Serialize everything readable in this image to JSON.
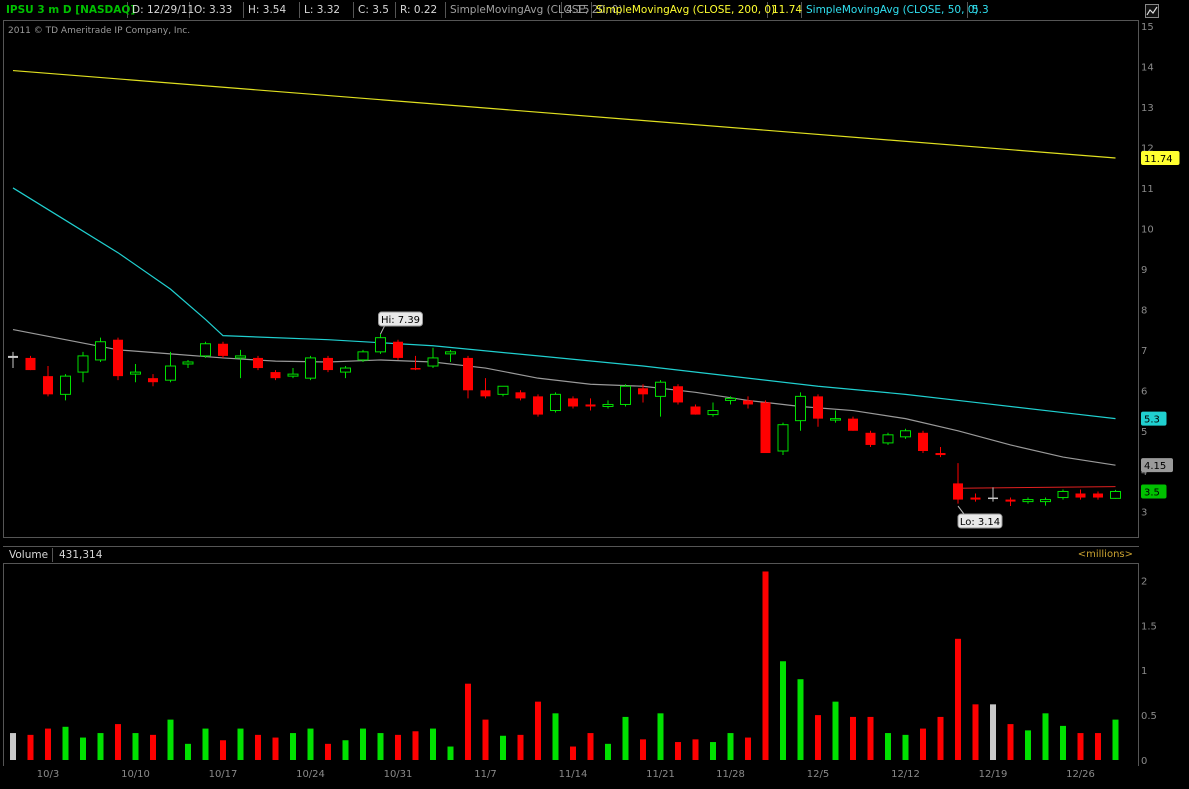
{
  "header": {
    "symbol": "IPSU 3 m D [NASDAQ]",
    "date": "D: 12/29/11",
    "open": "O: 3.33",
    "high": "H: 3.54",
    "low": "L: 3.32",
    "close": "C: 3.5",
    "range": "R: 0.22",
    "sma20_label": "SimpleMovingAvg (CLOSE, 20, 0)",
    "sma20_value": "4.15",
    "sma200_label": "SimpleMovingAvg (CLOSE, 200, 0)",
    "sma200_value": "11.74",
    "sma50_label": "SimpleMovingAvg (CLOSE, 50, 0)",
    "sma50_value": "5.3"
  },
  "copyright": "2011 © TD Ameritrade IP Company, Inc.",
  "volume_header": {
    "label": "Volume",
    "value": "431,314",
    "units": "<millions>"
  },
  "colors": {
    "up": "#00e000",
    "down": "#ff0000",
    "neutral": "#c8c8c8",
    "sma20": "#9a9a9a",
    "sma50": "#20d0d0",
    "sma200": "#e0e020",
    "symbol": "#00c000",
    "grid_text": "#8a8a8a"
  },
  "chart_data": [
    {
      "type": "candlestick",
      "title": "IPSU 3 m D [NASDAQ]",
      "y_ticks": [
        3,
        4,
        5,
        6,
        7,
        8,
        9,
        10,
        11,
        12,
        13,
        14,
        15
      ],
      "ylim": [
        2.4,
        15.1
      ],
      "x_tick_labels": [
        "10/3",
        "10/10",
        "10/17",
        "10/24",
        "10/31",
        "11/7",
        "11/14",
        "11/21",
        "11/28",
        "12/5",
        "12/12",
        "12/19",
        "12/26"
      ],
      "x_tick_index": [
        2,
        7,
        12,
        17,
        22,
        27,
        32,
        37,
        41,
        46,
        51,
        56,
        61
      ],
      "candles": [
        {
          "o": 6.8,
          "h": 6.95,
          "l": 6.55,
          "c": 6.85
        },
        {
          "o": 6.8,
          "h": 6.85,
          "l": 6.5,
          "c": 6.5
        },
        {
          "o": 6.35,
          "h": 6.6,
          "l": 5.85,
          "c": 5.9
        },
        {
          "o": 5.9,
          "h": 6.4,
          "l": 5.75,
          "c": 6.35
        },
        {
          "o": 6.45,
          "h": 6.95,
          "l": 6.2,
          "c": 6.85
        },
        {
          "o": 6.75,
          "h": 7.3,
          "l": 6.7,
          "c": 7.2
        },
        {
          "o": 7.25,
          "h": 7.3,
          "l": 6.25,
          "c": 6.35
        },
        {
          "o": 6.45,
          "h": 6.65,
          "l": 6.2,
          "c": 6.4
        },
        {
          "o": 6.3,
          "h": 6.4,
          "l": 6.1,
          "c": 6.2
        },
        {
          "o": 6.25,
          "h": 6.95,
          "l": 6.2,
          "c": 6.6
        },
        {
          "o": 6.65,
          "h": 6.75,
          "l": 6.55,
          "c": 6.7
        },
        {
          "o": 6.85,
          "h": 7.2,
          "l": 6.8,
          "c": 7.15
        },
        {
          "o": 7.15,
          "h": 7.2,
          "l": 6.8,
          "c": 6.85
        },
        {
          "o": 6.8,
          "h": 7.0,
          "l": 6.3,
          "c": 6.85
        },
        {
          "o": 6.8,
          "h": 6.85,
          "l": 6.5,
          "c": 6.55
        },
        {
          "o": 6.45,
          "h": 6.5,
          "l": 6.25,
          "c": 6.3
        },
        {
          "o": 6.35,
          "h": 6.55,
          "l": 6.3,
          "c": 6.4
        },
        {
          "o": 6.3,
          "h": 6.85,
          "l": 6.25,
          "c": 6.8
        },
        {
          "o": 6.8,
          "h": 6.85,
          "l": 6.45,
          "c": 6.5
        },
        {
          "o": 6.45,
          "h": 6.6,
          "l": 6.3,
          "c": 6.55
        },
        {
          "o": 6.75,
          "h": 7.0,
          "l": 6.7,
          "c": 6.95
        },
        {
          "o": 6.95,
          "h": 7.39,
          "l": 6.9,
          "c": 7.3
        },
        {
          "o": 7.2,
          "h": 7.25,
          "l": 6.75,
          "c": 6.8
        },
        {
          "o": 6.55,
          "h": 6.85,
          "l": 6.5,
          "c": 6.55
        },
        {
          "o": 6.6,
          "h": 7.05,
          "l": 6.55,
          "c": 6.8
        },
        {
          "o": 6.9,
          "h": 7.0,
          "l": 6.7,
          "c": 6.95
        },
        {
          "o": 6.8,
          "h": 6.85,
          "l": 5.8,
          "c": 6.0
        },
        {
          "o": 6.0,
          "h": 6.3,
          "l": 5.8,
          "c": 5.85
        },
        {
          "o": 5.9,
          "h": 6.1,
          "l": 5.85,
          "c": 6.1
        },
        {
          "o": 5.95,
          "h": 6.0,
          "l": 5.75,
          "c": 5.8
        },
        {
          "o": 5.85,
          "h": 5.9,
          "l": 5.35,
          "c": 5.4
        },
        {
          "o": 5.5,
          "h": 5.95,
          "l": 5.45,
          "c": 5.9
        },
        {
          "o": 5.8,
          "h": 5.85,
          "l": 5.55,
          "c": 5.6
        },
        {
          "o": 5.65,
          "h": 5.8,
          "l": 5.5,
          "c": 5.6
        },
        {
          "o": 5.6,
          "h": 5.75,
          "l": 5.55,
          "c": 5.65
        },
        {
          "o": 5.65,
          "h": 6.15,
          "l": 5.6,
          "c": 6.1
        },
        {
          "o": 6.05,
          "h": 6.15,
          "l": 5.7,
          "c": 5.9
        },
        {
          "o": 5.85,
          "h": 6.25,
          "l": 5.35,
          "c": 6.2
        },
        {
          "o": 6.1,
          "h": 6.15,
          "l": 5.65,
          "c": 5.7
        },
        {
          "o": 5.6,
          "h": 5.65,
          "l": 5.4,
          "c": 5.4
        },
        {
          "o": 5.4,
          "h": 5.7,
          "l": 5.35,
          "c": 5.5
        },
        {
          "o": 5.75,
          "h": 5.85,
          "l": 5.65,
          "c": 5.8
        },
        {
          "o": 5.75,
          "h": 5.85,
          "l": 5.55,
          "c": 5.65
        },
        {
          "o": 5.7,
          "h": 5.75,
          "l": 4.45,
          "c": 4.45
        },
        {
          "o": 4.5,
          "h": 5.2,
          "l": 4.4,
          "c": 5.15
        },
        {
          "o": 5.25,
          "h": 5.95,
          "l": 5.0,
          "c": 5.85
        },
        {
          "o": 5.85,
          "h": 5.9,
          "l": 5.1,
          "c": 5.3
        },
        {
          "o": 5.3,
          "h": 5.5,
          "l": 5.2,
          "c": 5.3
        },
        {
          "o": 5.3,
          "h": 5.35,
          "l": 5.0,
          "c": 5.0
        },
        {
          "o": 4.95,
          "h": 5.0,
          "l": 4.6,
          "c": 4.65
        },
        {
          "o": 4.7,
          "h": 4.95,
          "l": 4.65,
          "c": 4.9
        },
        {
          "o": 4.85,
          "h": 5.05,
          "l": 4.8,
          "c": 5.0
        },
        {
          "o": 4.95,
          "h": 5.0,
          "l": 4.45,
          "c": 4.5
        },
        {
          "o": 4.45,
          "h": 4.6,
          "l": 4.35,
          "c": 4.4
        },
        {
          "o": 3.7,
          "h": 4.2,
          "l": 3.2,
          "c": 3.3
        },
        {
          "o": 3.35,
          "h": 3.45,
          "l": 3.25,
          "c": 3.3
        },
        {
          "o": 3.35,
          "h": 3.6,
          "l": 3.25,
          "c": 3.35
        },
        {
          "o": 3.3,
          "h": 3.35,
          "l": 3.14,
          "c": 3.25
        },
        {
          "o": 3.25,
          "h": 3.35,
          "l": 3.2,
          "c": 3.3
        },
        {
          "o": 3.25,
          "h": 3.35,
          "l": 3.15,
          "c": 3.3
        },
        {
          "o": 3.35,
          "h": 3.55,
          "l": 3.3,
          "c": 3.5
        },
        {
          "o": 3.45,
          "h": 3.55,
          "l": 3.3,
          "c": 3.35
        },
        {
          "o": 3.45,
          "h": 3.5,
          "l": 3.3,
          "c": 3.35
        },
        {
          "o": 3.33,
          "h": 3.54,
          "l": 3.32,
          "c": 3.5
        }
      ],
      "dirs": [
        "n",
        "d",
        "d",
        "u",
        "u",
        "u",
        "d",
        "u",
        "d",
        "u",
        "u",
        "u",
        "d",
        "u",
        "d",
        "d",
        "u",
        "u",
        "d",
        "u",
        "u",
        "u",
        "d",
        "d",
        "u",
        "u",
        "d",
        "d",
        "u",
        "d",
        "d",
        "u",
        "d",
        "d",
        "u",
        "u",
        "d",
        "u",
        "d",
        "d",
        "u",
        "u",
        "d",
        "d",
        "u",
        "u",
        "d",
        "u",
        "d",
        "d",
        "u",
        "u",
        "d",
        "d",
        "d",
        "d",
        "n",
        "d",
        "u",
        "u",
        "u",
        "d",
        "d",
        "u"
      ],
      "series": [
        {
          "name": "SimpleMovingAvg (CLOSE, 200, 0)",
          "last": 11.74,
          "values_start_end": [
            13.9,
            11.74
          ]
        },
        {
          "name": "SimpleMovingAvg (CLOSE, 50, 0)",
          "last": 5.3
        },
        {
          "name": "SimpleMovingAvg (CLOSE, 20, 0)",
          "last": 4.15
        }
      ],
      "sma50_path": [
        [
          0,
          11.0
        ],
        [
          3,
          10.2
        ],
        [
          6,
          9.4
        ],
        [
          9,
          8.5
        ],
        [
          11,
          7.75
        ],
        [
          12,
          7.35
        ],
        [
          18,
          7.25
        ],
        [
          24,
          7.1
        ],
        [
          30,
          6.85
        ],
        [
          36,
          6.6
        ],
        [
          41,
          6.35
        ],
        [
          46,
          6.1
        ],
        [
          51,
          5.9
        ],
        [
          55,
          5.7
        ],
        [
          60,
          5.45
        ],
        [
          63,
          5.3
        ]
      ],
      "sma20_path": [
        [
          0,
          7.5
        ],
        [
          3,
          7.25
        ],
        [
          6,
          7.0
        ],
        [
          9,
          6.9
        ],
        [
          12,
          6.8
        ],
        [
          15,
          6.72
        ],
        [
          18,
          6.7
        ],
        [
          21,
          6.75
        ],
        [
          24,
          6.7
        ],
        [
          27,
          6.55
        ],
        [
          30,
          6.3
        ],
        [
          33,
          6.15
        ],
        [
          36,
          6.1
        ],
        [
          39,
          5.95
        ],
        [
          42,
          5.75
        ],
        [
          45,
          5.6
        ],
        [
          48,
          5.5
        ],
        [
          51,
          5.3
        ],
        [
          54,
          5.0
        ],
        [
          57,
          4.65
        ],
        [
          60,
          4.35
        ],
        [
          63,
          4.15
        ]
      ],
      "annotations": [
        {
          "text": "Hi: 7.39",
          "index": 21,
          "price": 7.39
        },
        {
          "text": "Lo: 3.14",
          "index": 54,
          "price": 3.14
        }
      ],
      "price_labels": [
        {
          "text": "11.74",
          "price": 11.74,
          "color": "#ffff30"
        },
        {
          "text": "5.3",
          "price": 5.3,
          "color": "#20d0d0"
        },
        {
          "text": "4.15",
          "price": 4.15,
          "color": "#9a9a9a"
        },
        {
          "text": "3.5",
          "price": 3.5,
          "color": "#00c000"
        }
      ]
    },
    {
      "type": "bar",
      "title": "Volume",
      "units": "millions",
      "y_ticks": [
        0,
        0.5,
        1,
        1.5,
        2
      ],
      "ylim": [
        0,
        2.15
      ],
      "values": [
        0.3,
        0.28,
        0.35,
        0.37,
        0.25,
        0.3,
        0.4,
        0.3,
        0.28,
        0.45,
        0.18,
        0.35,
        0.22,
        0.35,
        0.28,
        0.25,
        0.3,
        0.35,
        0.18,
        0.22,
        0.35,
        0.3,
        0.28,
        0.32,
        0.35,
        0.15,
        0.85,
        0.45,
        0.27,
        0.28,
        0.65,
        0.52,
        0.15,
        0.3,
        0.18,
        0.48,
        0.23,
        0.52,
        0.2,
        0.23,
        0.2,
        0.3,
        0.25,
        2.1,
        1.1,
        0.9,
        0.5,
        0.65,
        0.48,
        0.48,
        0.3,
        0.28,
        0.35,
        0.48,
        1.35,
        0.62,
        0.62,
        0.4,
        0.33,
        0.52,
        0.38,
        0.3,
        0.3,
        0.45
      ]
    }
  ]
}
